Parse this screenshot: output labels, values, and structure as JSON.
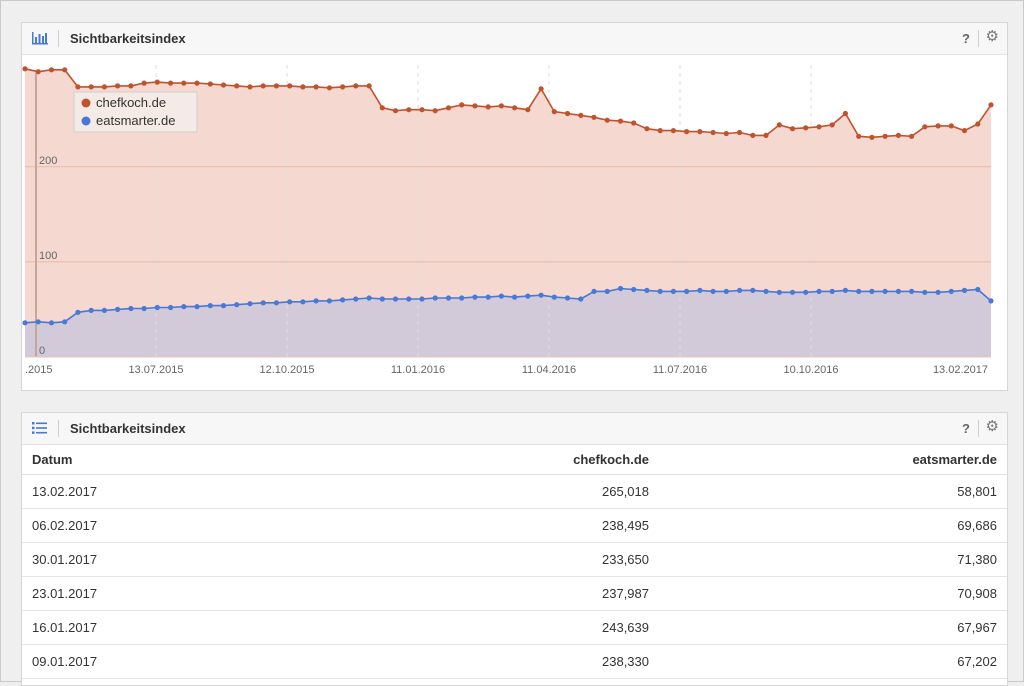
{
  "chart_panel": {
    "title": "Sichtbarkeitsindex",
    "help": "?"
  },
  "table_panel": {
    "title": "Sichtbarkeitsindex",
    "help": "?"
  },
  "icons": {
    "chart": "bar-chart-icon",
    "list": "list-icon",
    "settings": "gear-icon"
  },
  "colors": {
    "chefkoch": "#c0532e",
    "eatsmarter": "#4a78d6",
    "chef_fill": "#f5d9d0",
    "eat_fill": "#d2cad8"
  },
  "chart_data": {
    "type": "area",
    "title": "Sichtbarkeitsindex",
    "xlabel": "",
    "ylabel": "",
    "ylim": [
      0,
      307
    ],
    "ytick_labels": [
      "0",
      "100",
      "200"
    ],
    "yticks": [
      0,
      100,
      200
    ],
    "xtick_labels": [
      ".2015",
      "13.07.2015",
      "12.10.2015",
      "11.01.2016",
      "11.04.2016",
      "11.07.2016",
      "10.10.2016",
      "13.02.2017"
    ],
    "grid": true,
    "legend_position": "top-left",
    "series": [
      {
        "name": "chefkoch.de",
        "values": [
          303,
          300,
          302,
          302,
          284,
          284,
          284,
          285,
          285,
          288,
          289,
          288,
          288,
          288,
          287,
          286,
          285,
          284,
          285,
          285,
          285,
          284,
          284,
          283,
          284,
          285,
          285,
          262,
          259,
          260,
          260,
          259,
          262,
          265,
          264,
          263,
          264,
          262,
          260,
          282,
          258,
          256,
          254,
          252,
          249,
          248,
          246,
          240,
          238,
          238,
          237,
          237,
          236,
          235,
          236,
          233,
          233,
          244,
          240,
          241,
          242,
          244,
          256,
          232,
          231,
          232,
          233,
          232,
          242,
          243,
          243,
          238,
          245,
          265
        ]
      },
      {
        "name": "eatsmarter.de",
        "values": [
          36,
          37,
          36,
          37,
          47,
          49,
          49,
          50,
          51,
          51,
          52,
          52,
          53,
          53,
          54,
          54,
          55,
          56,
          57,
          57,
          58,
          58,
          59,
          59,
          60,
          61,
          62,
          61,
          61,
          61,
          61,
          62,
          62,
          62,
          63,
          63,
          64,
          63,
          64,
          65,
          63,
          62,
          61,
          69,
          69,
          72,
          71,
          70,
          69,
          69,
          69,
          70,
          69,
          69,
          70,
          70,
          69,
          68,
          68,
          68,
          69,
          69,
          70,
          69,
          69,
          69,
          69,
          69,
          68,
          68,
          69,
          70,
          71,
          59
        ]
      }
    ]
  },
  "table": {
    "headers": [
      "Datum",
      "chefkoch.de",
      "eatsmarter.de"
    ],
    "rows": [
      [
        "13.02.2017",
        "265,018",
        "58,801"
      ],
      [
        "06.02.2017",
        "238,495",
        "69,686"
      ],
      [
        "30.01.2017",
        "233,650",
        "71,380"
      ],
      [
        "23.01.2017",
        "237,987",
        "70,908"
      ],
      [
        "16.01.2017",
        "243,639",
        "67,967"
      ],
      [
        "09.01.2017",
        "238,330",
        "67,202"
      ]
    ]
  }
}
